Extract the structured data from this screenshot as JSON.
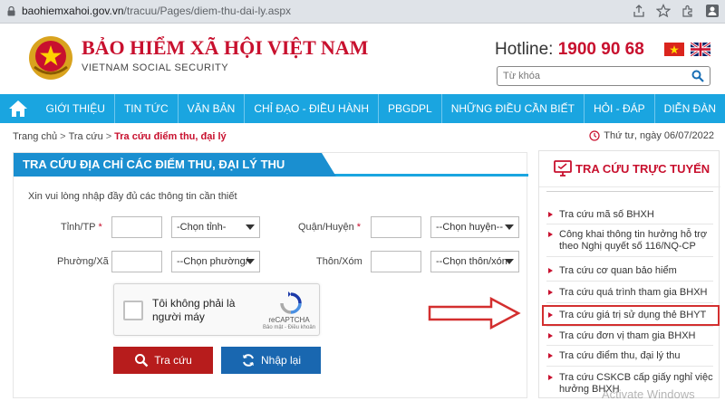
{
  "browser": {
    "url_host": "baohiemxahoi.gov.vn",
    "url_path": "/tracuu/Pages/diem-thu-dai-ly.aspx"
  },
  "header": {
    "title": "BẢO HIỂM XÃ HỘI VIỆT NAM",
    "subtitle": "VIETNAM SOCIAL SECURITY",
    "hotline_label": "Hotline:",
    "hotline_number": "1900 90 68",
    "search_placeholder": "Từ khóa"
  },
  "nav": {
    "items": [
      "GIỚI THIỆU",
      "TIN TỨC",
      "VĂN BẢN",
      "CHỈ ĐẠO - ĐIỀU HÀNH",
      "PBGDPL",
      "NHỮNG ĐIỀU CẦN BIẾT",
      "HỎI - ĐÁP",
      "DIỄN ĐÀN"
    ]
  },
  "breadcrumb": {
    "home": "Trang chủ",
    "sep": ">",
    "parent": "Tra cứu",
    "current": "Tra cứu điểm thu, đại lý"
  },
  "date": "Thứ tư, ngày 06/07/2022",
  "form": {
    "title": "TRA CỨU ĐỊA CHỈ CÁC ĐIỂM THU, ĐẠI LÝ THU",
    "instruction": "Xin vui lòng nhập đầy đủ các thông tin cần thiết",
    "required_mark": "*",
    "province_label": "Tỉnh/TP",
    "province_select": "-Chọn tỉnh-",
    "district_label": "Quận/Huyện",
    "district_select": "--Chọn huyện--",
    "ward_label": "Phường/Xã",
    "ward_select": "--Chọn phường/",
    "village_label": "Thôn/Xóm",
    "village_select": "--Chọn thôn/xón",
    "captcha_text": "Tôi không phải là người máy",
    "captcha_brand": "reCAPTCHA",
    "captcha_terms": "Bảo mật - Điều khoản",
    "search_button": "Tra cứu",
    "reset_button": "Nhập lại"
  },
  "sidebar": {
    "title": "TRA CỨU TRỰC TUYẾN",
    "links": [
      "Tra cứu mã số BHXH",
      "Công khai thông tin hưởng hỗ trợ theo Nghị quyết số 116/NQ-CP",
      "Tra cứu cơ quan bảo hiểm",
      "Tra cứu quá trình tham gia BHXH",
      "Tra cứu giá trị sử dụng thẻ BHYT",
      "Tra cứu đơn vị tham gia BHXH",
      "Tra cứu điểm thu, đại lý thu",
      "Tra cứu CSKCB cấp giấy nghỉ việc hưởng BHXH"
    ]
  },
  "watermark": "Activate Windows",
  "colors": {
    "brand_red": "#c8102e",
    "nav_blue": "#1aa5e0",
    "tab_blue": "#1a8fd0",
    "button_red": "#b71c1c",
    "button_blue": "#1967b0"
  }
}
